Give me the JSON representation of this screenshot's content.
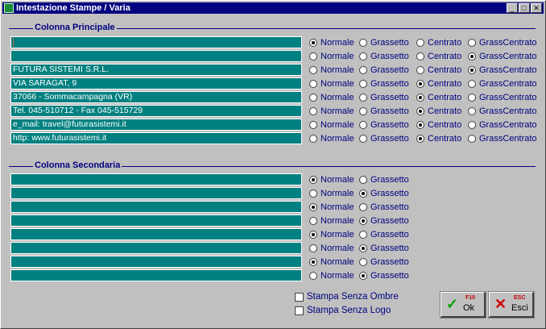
{
  "window": {
    "title": "Intestazione Stampe / Varia"
  },
  "principale": {
    "label": "Colonna Principale",
    "options": [
      "Normale",
      "Grassetto",
      "Centrato",
      "GrassCentrato"
    ],
    "rows": [
      {
        "text": "",
        "selected": 0
      },
      {
        "text": "",
        "selected": 3
      },
      {
        "text": "FUTURA SISTEMI S.R.L.",
        "selected": 3
      },
      {
        "text": "VIA SARAGAT, 9",
        "selected": 2
      },
      {
        "text": "37066 - Sommacampagna (VR)",
        "selected": 2
      },
      {
        "text": "Tel. 045-510712 - Fax 045-515729",
        "selected": 2
      },
      {
        "text": "e_mail: travel@futurasistemi.it",
        "selected": 2
      },
      {
        "text": "http: www.futurasistemi.it",
        "selected": 2
      }
    ]
  },
  "secondaria": {
    "label": "Colonna Secondaria",
    "options": [
      "Normale",
      "Grassetto"
    ],
    "rows": [
      {
        "text": "",
        "selected": 0
      },
      {
        "text": "",
        "selected": 1
      },
      {
        "text": "",
        "selected": 0
      },
      {
        "text": "",
        "selected": 1
      },
      {
        "text": "",
        "selected": 0
      },
      {
        "text": "",
        "selected": 1
      },
      {
        "text": "",
        "selected": 0
      },
      {
        "text": "",
        "selected": 1
      }
    ]
  },
  "checkboxes": [
    {
      "label": "Stampa Senza Ombre",
      "checked": false
    },
    {
      "label": "Stampa Senza Logo",
      "checked": false
    }
  ],
  "buttons": {
    "ok": {
      "key": "F10",
      "label": "Ok",
      "icon": "check-icon",
      "color": "#00a000"
    },
    "esc": {
      "key": "ESC",
      "label": "Esci",
      "icon": "x-icon",
      "color": "#d00000"
    }
  }
}
